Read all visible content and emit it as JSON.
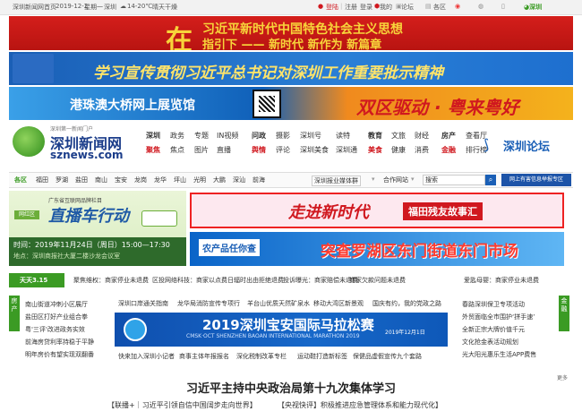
{
  "topbar": {
    "items": [
      "深圳新闻网首页",
      "2019-12-2",
      "星期一",
      "深圳",
      "14-20℃",
      "晴天干燥"
    ],
    "login": "登陆",
    "register": "注册",
    "leave": "登录",
    "about": "我的",
    "forum": "论坛",
    "area": "各区"
  },
  "banner1": {
    "text1": "在",
    "text2": "习近平新时代中国特色社会主义思想",
    "text3": "指引下 —— 新时代  新作为  新篇章"
  },
  "banner2": {
    "text": "学习宣传贯彻习近平总书记对深圳工作重要批示精神"
  },
  "banner3": {
    "text1": "港珠澳大桥网上展览馆",
    "text2": "双区驱动 · 粤来粤好"
  },
  "logo": {
    "slogan": "深圳第一新闻门户",
    "name": "深圳新闻网",
    "domain": "sznews.com"
  },
  "nav": {
    "columns": [
      [
        "深圳",
        "聚焦"
      ],
      [
        "政务",
        "焦点"
      ],
      [
        "专题",
        "图片"
      ],
      [
        "IN视频",
        "直播"
      ],
      [
        "问政",
        "舆情"
      ],
      [
        "摄影",
        "评论"
      ],
      [
        "深圳号",
        "深圳美食"
      ],
      [
        "读特",
        "深圳通"
      ],
      [
        "教育",
        "美食"
      ],
      [
        "文旅",
        "健康"
      ],
      [
        "财经",
        "消费"
      ],
      [
        "房产",
        "金融"
      ],
      [
        "查看厅",
        "排行榜"
      ]
    ]
  },
  "forum": {
    "label": "深圳论坛"
  },
  "chanbar": {
    "items": [
      "各区",
      "福田",
      "罗湖",
      "盐田",
      "南山",
      "宝安",
      "龙岗",
      "龙华",
      "坪山",
      "光明",
      "大鹏",
      "深汕",
      "前海"
    ],
    "group": "深圳报业媒体群",
    "partner": "合作网站",
    "search_label": "搜索",
    "report": "网上有害信息举报专区"
  },
  "promo": {
    "header": "广东省互联网品牌栏目",
    "title": "直播车行动",
    "date": "时间：2019年11月24日（周日）15:00—17:30",
    "place": "地点：深圳商报社大厦二楼沙龙会议室",
    "badge": "网红区"
  },
  "promo_r1": {
    "title": "走进新时代",
    "subtitle": "福田残友故事汇"
  },
  "promo_r2": {
    "tag": "农产品任你查",
    "title": "突查罗湖区东门街道东门市场"
  },
  "ticker": {
    "badge": "天天3.15",
    "items": [
      "聚焦维权：商家停业未退费",
      "区投网络科技：商家以点费日辐时出由拒绝退费",
      "投诉曝光：商家赔偿未退费",
      "商家处理不解决用户不执行",
      "报业集团投诉公告",
      "商家欠款问题未退费",
      "爱匙母婴：商家停业未退费"
    ]
  },
  "left_news": [
    "南山街道冲刺小区展厅",
    "盐田区打好产业组合拳",
    "粤'三评'改进政务实效",
    "前海房贷利率持稳于平静",
    "明年房价有望实现双翻番"
  ],
  "right_news": [
    "春路深圳保卫专项活动",
    "外贸面临全市围护‘拼手速’",
    "全新正宗大牌价值千元",
    "文化抢金表活动规划",
    "光大阳光惠乐生活APP费售"
  ],
  "mid_news": {
    "row1": [
      "深圳口岸通关指南",
      "龙华局消防宣传专项行",
      "羊台山优质天然矿泉水",
      "移动大湾区新景观",
      "国庆有约，我的党政之路"
    ],
    "row2": [
      "快来加入深圳小记者",
      "商事主体年报报名",
      "深化税制改革专栏",
      "运动鞋打造新标签",
      "保健品虚假宣传九个套路"
    ]
  },
  "marathon": {
    "title": "2019深圳宝安国际马拉松赛",
    "subtitle": "CMSK·OCT SHENZHEN BAOAN INTERNATIONAL MARATHON 2019",
    "date": "2019年12月1日"
  },
  "side_tags": {
    "left": "房产",
    "right": "金融"
  },
  "headline": {
    "title": "习近平主持中央政治局第十九次集体学习",
    "sub1": "【联播+｜习近平引领自信中国阔步走向世界】",
    "sub2": "【央视快评】积极推进应急管理体系和能力现代化】"
  },
  "more": {
    "label": "更多"
  },
  "colors": {
    "brand_red": "#d0181f",
    "brand_green": "#3b9b24",
    "link_blue": "#1a5fb6"
  }
}
